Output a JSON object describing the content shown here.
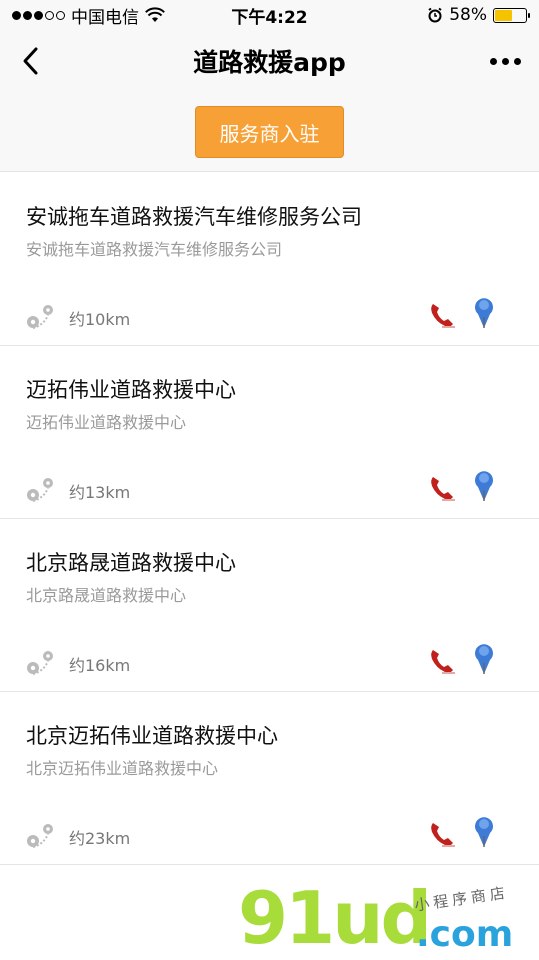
{
  "status_bar": {
    "carrier": "中国电信",
    "time": "下午4:22",
    "battery": "58%",
    "battery_level": 0.58
  },
  "nav": {
    "title": "道路救援app"
  },
  "join_button": {
    "label": "服务商入驻",
    "color": "#f7a035"
  },
  "providers": [
    {
      "name": "安诚拖车道路救援汽车维修服务公司",
      "subtitle": "安诚拖车道路救援汽车维修服务公司",
      "distance": "约10km"
    },
    {
      "name": "迈拓伟业道路救援中心",
      "subtitle": "迈拓伟业道路救援中心",
      "distance": "约13km"
    },
    {
      "name": "北京路晟道路救援中心",
      "subtitle": "北京路晟道路救援中心",
      "distance": "约16km"
    },
    {
      "name": "北京迈拓伟业道路救援中心",
      "subtitle": "北京迈拓伟业道路救援中心",
      "distance": "约23km"
    }
  ],
  "icons": {
    "route": "route-icon",
    "phone": "phone-icon",
    "location": "location-pin-icon"
  },
  "watermark": {
    "brand": "91ud",
    "domain": ".com",
    "tagline": "小程序商店"
  }
}
